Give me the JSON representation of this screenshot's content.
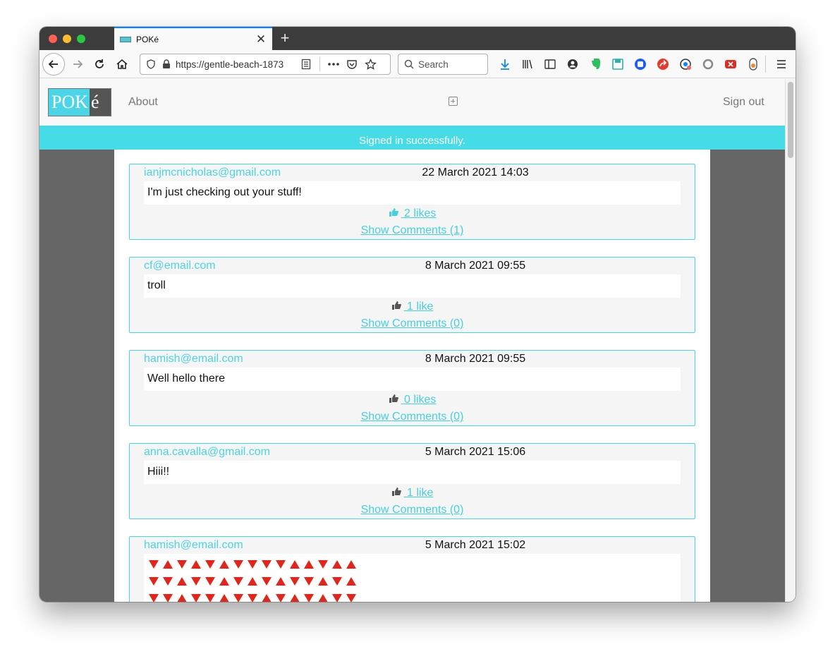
{
  "browser": {
    "tab_title": "POKé",
    "new_tab_label": "+",
    "tab_close_label": "✕",
    "url": "https://gentle-beach-1873",
    "search_placeholder": "Search"
  },
  "site": {
    "logo_main": "POK",
    "logo_end": "é",
    "about_label": "About",
    "signout_label": "Sign out",
    "flash_message": "Signed in successfully.",
    "accent_color": "#45dce8"
  },
  "posts": [
    {
      "author": "ianjmcnicholas@gmail.com",
      "date": "22 March 2021 14:03",
      "body": "I'm just checking out your stuff!",
      "likes": " 2 likes",
      "liked": true,
      "comments": "Show Comments (1)"
    },
    {
      "author": "cf@email.com",
      "date": "8 March 2021 09:55",
      "body": "troll",
      "likes": " 1 like",
      "liked": false,
      "comments": "Show Comments (0)"
    },
    {
      "author": "hamish@email.com",
      "date": "8 March 2021 09:55",
      "body": "Well hello there",
      "likes": " 0 likes",
      "liked": false,
      "comments": "Show Comments (0)"
    },
    {
      "author": "anna.cavalla@gmail.com",
      "date": "5 March 2021 15:06",
      "body": "Hiii!!",
      "likes": " 1 like",
      "liked": false,
      "comments": "Show Comments (0)"
    },
    {
      "author": "hamish@email.com",
      "date": "5 March 2021 15:02",
      "emoji_rows": [
        [
          "down",
          "up",
          "down",
          "up",
          "down",
          "up",
          "down",
          "down",
          "down",
          "down",
          "up",
          "up",
          "down",
          "up",
          "up"
        ],
        [
          "down",
          "down",
          "up",
          "down",
          "down",
          "up",
          "down",
          "up",
          "down",
          "up",
          "down",
          "down",
          "up",
          "down",
          "up"
        ],
        [
          "down",
          "down",
          "up",
          "down",
          "down",
          "up",
          "down",
          "down",
          "up",
          "down",
          "up",
          "down",
          "up",
          "down",
          "down"
        ]
      ]
    }
  ]
}
